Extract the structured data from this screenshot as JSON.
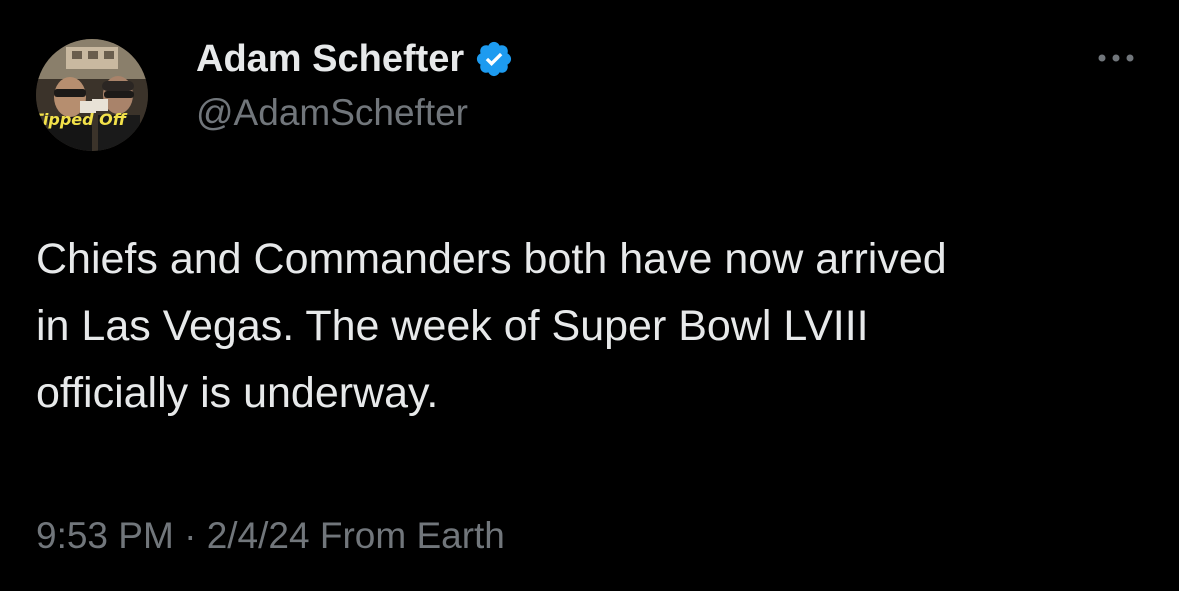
{
  "author": {
    "display_name": "Adam Schefter",
    "handle": "@AdamSchefter",
    "verified_icon": "verified-badge-icon",
    "verified_color": "#1d9bf0",
    "avatar_caption": "Tipped Off"
  },
  "tweet": {
    "lines": [
      "Chiefs and Commanders both have now arrived",
      "in Las Vegas. The week of Super Bowl LVIII",
      "officially is underway."
    ]
  },
  "meta": {
    "time": "9:53 PM",
    "separator": " · ",
    "date": "2/4/24",
    "location": " From Earth"
  },
  "colors": {
    "background": "#000000",
    "primary_text": "#e7e9ea",
    "secondary_text": "#71767b"
  },
  "icons": {
    "more": "more-horizontal-icon"
  }
}
